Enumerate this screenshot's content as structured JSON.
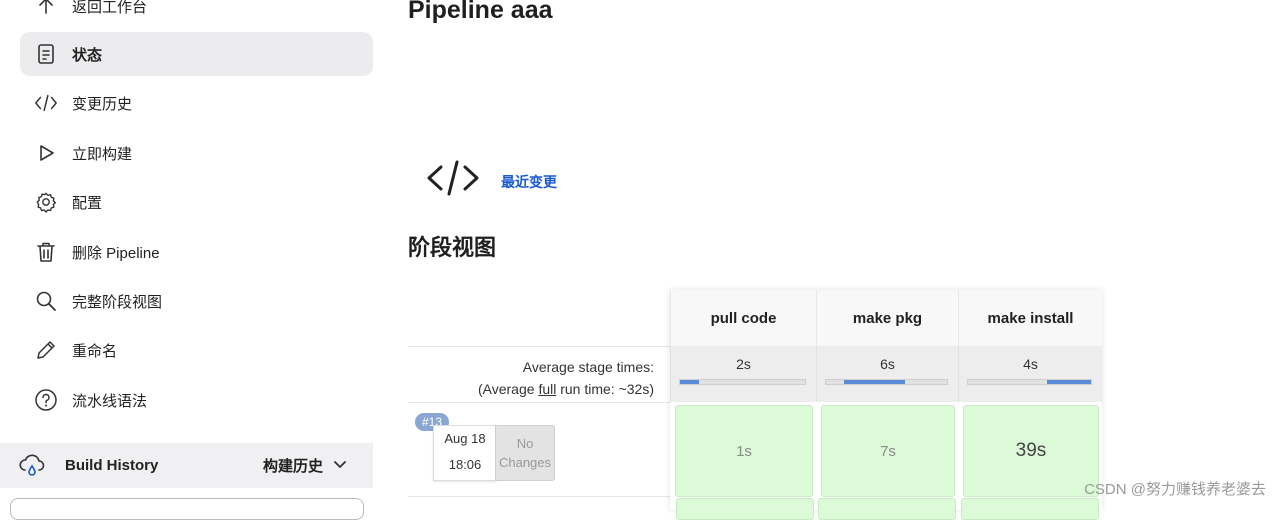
{
  "sidebar": {
    "items": [
      {
        "label": "返回工作台",
        "icon": "arrow-up-icon"
      },
      {
        "label": "状态",
        "icon": "document-icon",
        "active": true
      },
      {
        "label": "变更历史",
        "icon": "code-icon"
      },
      {
        "label": "立即构建",
        "icon": "play-icon"
      },
      {
        "label": "配置",
        "icon": "gear-icon"
      },
      {
        "label": "删除 Pipeline",
        "icon": "trash-icon"
      },
      {
        "label": "完整阶段视图",
        "icon": "search-icon"
      },
      {
        "label": "重命名",
        "icon": "pencil-icon"
      },
      {
        "label": "流水线语法",
        "icon": "help-icon"
      }
    ],
    "build_history": {
      "title": "Build History",
      "toggle_label": "构建历史",
      "icon": "cloud-rain-icon"
    }
  },
  "main": {
    "title": "Pipeline aaa",
    "recent_changes_label": "最近变更",
    "stage_view_heading": "阶段视图"
  },
  "stage_view": {
    "avg_label_line1": "Average stage times:",
    "avg_label_prefix": "(Average ",
    "avg_label_link": "full",
    "avg_label_suffix": " run time: ~32s)",
    "stages": [
      {
        "name": "pull code",
        "avg": "2s",
        "bar_start": 0.0,
        "bar_fraction": 0.15
      },
      {
        "name": "make pkg",
        "avg": "6s",
        "bar_start": 0.15,
        "bar_fraction": 0.5
      },
      {
        "name": "make install",
        "avg": "4s",
        "bar_start": 0.64,
        "bar_fraction": 0.36
      }
    ],
    "runs": [
      {
        "id": "#13",
        "date": "Aug 18",
        "time": "18:06",
        "changes": "No Changes",
        "stage_times": [
          "1s",
          "7s",
          "39s"
        ]
      }
    ]
  },
  "watermark": "CSDN @努力赚钱养老婆去",
  "colors": {
    "accent_link": "#1a5bd0",
    "success_cell": "#dcf9d8",
    "progress_fill": "#5b8bd9",
    "badge": "#8aa6d2"
  }
}
